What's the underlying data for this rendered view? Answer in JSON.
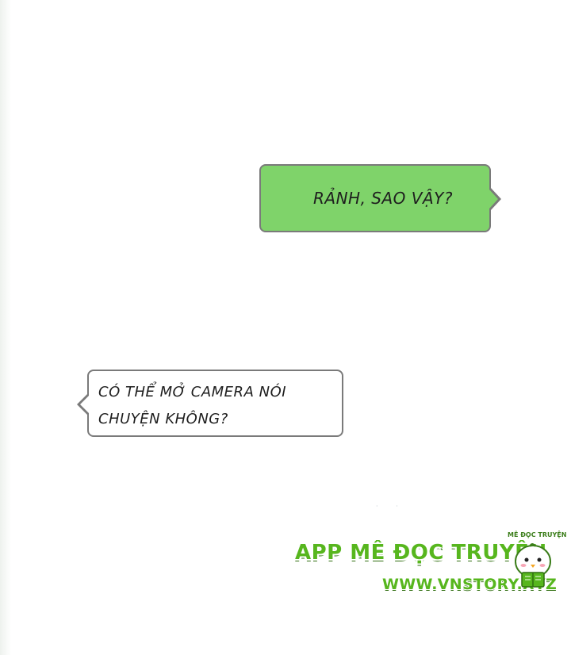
{
  "messages": [
    {
      "side": "right",
      "color": "green",
      "lines": [
        "RẢNH, SAO VẬY?"
      ]
    },
    {
      "side": "left",
      "color": "white",
      "lines": [
        "CÓ THỂ MỞ CAMERA NÓI",
        "CHUYỆN KHÔNG?"
      ]
    }
  ],
  "watermark": {
    "title": "APP MÊ ĐỌC TRUYỆN",
    "url": "WWW.VNSTORY.XYZ",
    "mini_label": "MÊ ĐỌC TRUYỆN",
    "mascot_icon": "chick-reading-book-icon",
    "color": "#57b61e"
  },
  "colors": {
    "green_bubble": "#7fd36a",
    "white_bubble": "#ffffff",
    "bubble_border": "#7a7a7a"
  }
}
